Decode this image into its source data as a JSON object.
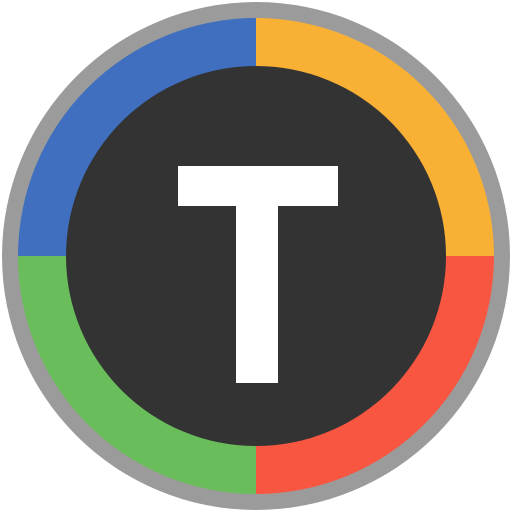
{
  "icon": {
    "name": "t-letter-app-icon",
    "glyph_name": "letter-t-glyph",
    "colors": {
      "outer_ring": "#9b9b9b",
      "top_left": "#3f6fbe",
      "top_right": "#f8b135",
      "bottom_right": "#f95642",
      "bottom_left": "#69bd5a",
      "center": "#333333",
      "glyph": "#ffffff"
    }
  }
}
